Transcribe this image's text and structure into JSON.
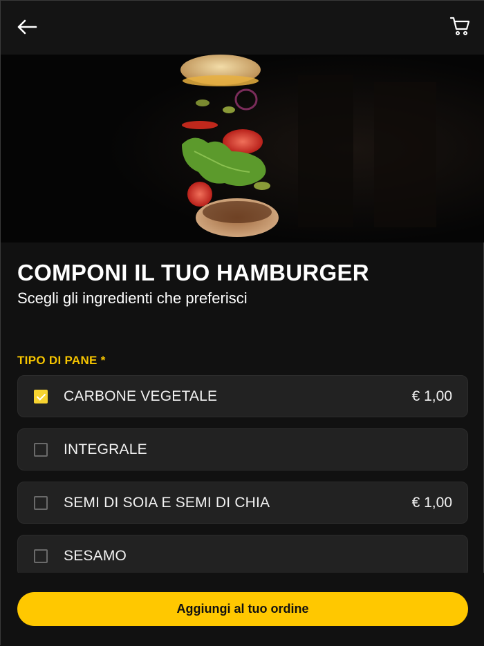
{
  "header": {
    "back_icon": "arrow-left-icon",
    "cart_icon": "shopping-cart-icon"
  },
  "hero": {
    "image": "burger-ingredients-photo"
  },
  "main": {
    "title": "COMPONI IL TUO HAMBURGER",
    "subtitle": "Scegli gli ingredienti che preferisci"
  },
  "section": {
    "label": "TIPO DI PANE *",
    "options": [
      {
        "label": "CARBONE VEGETALE",
        "price": "€ 1,00",
        "checked": true
      },
      {
        "label": "INTEGRALE",
        "price": "",
        "checked": false
      },
      {
        "label": "SEMI DI SOIA E SEMI DI CHIA",
        "price": "€ 1,00",
        "checked": false
      },
      {
        "label": "SESAMO",
        "price": "",
        "checked": false
      }
    ]
  },
  "footer": {
    "add_button_label": "Aggiungi al tuo ordine"
  },
  "colors": {
    "accent": "#ffc800",
    "section_label": "#f5c400",
    "background": "#111111",
    "card": "#222222"
  }
}
